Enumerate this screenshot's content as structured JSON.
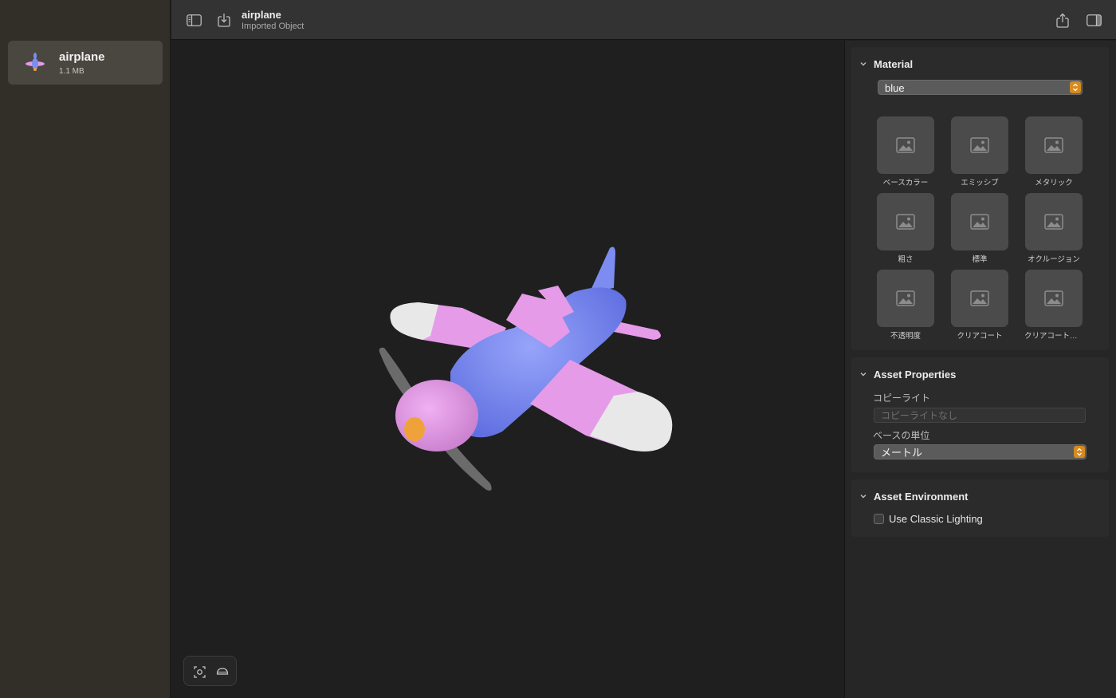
{
  "sidebar": {
    "file": {
      "name": "airplane",
      "size": "1.1 MB"
    }
  },
  "toolbar": {
    "title": "airplane",
    "subtitle": "Imported Object"
  },
  "inspector": {
    "material": {
      "title": "Material",
      "selected": "blue",
      "textures": [
        {
          "label": "ベースカラー"
        },
        {
          "label": "エミッシブ"
        },
        {
          "label": "メタリック"
        },
        {
          "label": "粗さ"
        },
        {
          "label": "標準"
        },
        {
          "label": "オクルージョン"
        },
        {
          "label": "不透明度"
        },
        {
          "label": "クリアコート"
        },
        {
          "label": "クリアコートの…"
        }
      ]
    },
    "asset_properties": {
      "title": "Asset Properties",
      "copyright_label": "コピーライト",
      "copyright_placeholder": "コピーライトなし",
      "base_unit_label": "ベースの単位",
      "base_unit_value": "メートル"
    },
    "asset_environment": {
      "title": "Asset Environment",
      "classic_lighting_label": "Use Classic Lighting",
      "classic_lighting_checked": false
    }
  },
  "colors": {
    "accent": "#d78a1f",
    "sidebar_bg": "#322f29",
    "plane_body": "#7d8cf0",
    "plane_wing": "#e59be8",
    "plane_tip": "#e5e5e5",
    "propeller": "#6b6b6b",
    "spinner": "#f0a23a"
  },
  "icons": [
    "sidebar-toggle-icon",
    "import-icon",
    "share-icon",
    "inspector-toggle-icon",
    "frame-object-icon",
    "environment-icon",
    "image-placeholder-icon",
    "chevron-down-icon",
    "up-down-arrows-icon"
  ]
}
